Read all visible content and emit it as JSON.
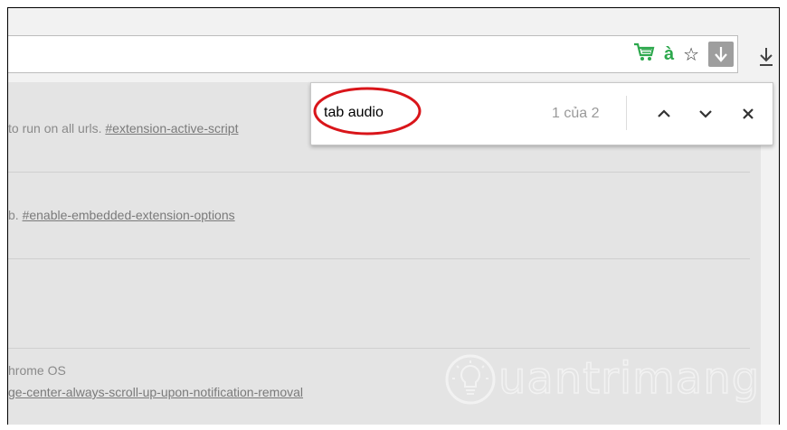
{
  "browser": {
    "omnibox": {
      "extension_icons": [
        "shopping-cart-icon",
        "a-grave-icon",
        "star-icon",
        "download-arrow-icon"
      ]
    },
    "toolbar_icons": [
      "download-icon"
    ]
  },
  "find_bar": {
    "query": "tab audio",
    "match_count": "1 của 2",
    "highlight_color": "#d9151a"
  },
  "flags_page": {
    "rows": [
      {
        "text": "to run on all urls. ",
        "link": "#extension-active-script"
      },
      {
        "text": "b. ",
        "link": "#enable-embedded-extension-options"
      },
      {
        "text": "",
        "link": ""
      },
      {
        "text": "hrome OS",
        "link": "ge-center-always-scroll-up-upon-notification-removal"
      }
    ]
  },
  "watermark": {
    "text": "uantrimang"
  },
  "colors": {
    "accent_green": "#2da84d",
    "page_bg": "#e4e4e4"
  }
}
